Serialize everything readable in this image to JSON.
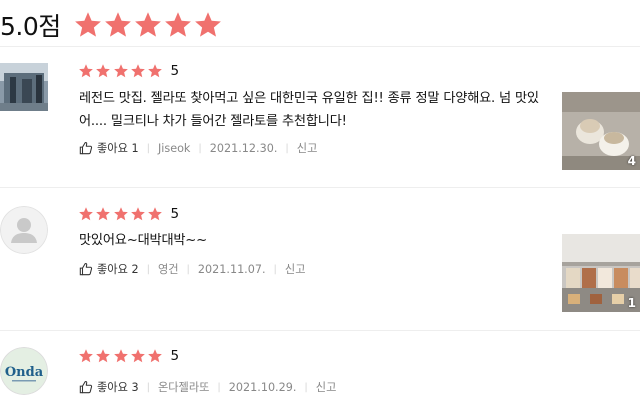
{
  "summary": {
    "score_text": "5.0점",
    "stars": 5
  },
  "colors": {
    "star": "#f0716e",
    "divider": "#eeeeee",
    "meta_text": "#888888"
  },
  "reviews": [
    {
      "rating": "5",
      "text": "레전드 맛집. 젤라또 찾아먹고 싶은 대한민국 유일한 집!! 종류 정말 다양해요. 넘 맛있어.... 밀크티나 차가 들어간 젤라토를 추천합니다!",
      "like_label": "좋아요",
      "like_count": "1",
      "author": "Jiseok",
      "date": "2021.12.30.",
      "report": "신고",
      "photo_count": "4"
    },
    {
      "rating": "5",
      "text": "맛있어요~대박대박~~",
      "like_label": "좋아요",
      "like_count": "2",
      "author": "영건",
      "date": "2021.11.07.",
      "report": "신고",
      "photo_count": "1"
    },
    {
      "rating": "5",
      "text": "",
      "like_label": "좋아요",
      "like_count": "3",
      "author": "온다젤라또",
      "date": "2021.10.29.",
      "report": "신고",
      "avatar_logo_text": "Onda"
    }
  ]
}
